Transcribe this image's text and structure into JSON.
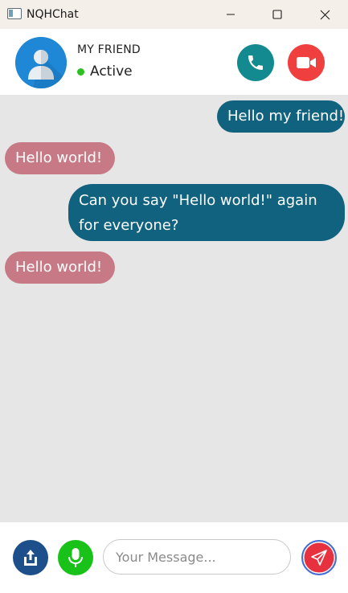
{
  "window": {
    "title": "NQHChat",
    "icons": [
      "app-window-icon",
      "minimize-icon",
      "maximize-icon",
      "close-icon"
    ]
  },
  "header": {
    "friend_name": "MY FRIEND",
    "status": "Active",
    "status_color": "#2cc020",
    "avatar_icon": "user-avatar-icon",
    "call_icon": "phone-icon",
    "video_icon": "video-camera-icon",
    "call_color": "#138a8f",
    "video_color": "#ef3f3f"
  },
  "messages": [
    {
      "direction": "outgoing",
      "text": "Hello my friend!"
    },
    {
      "direction": "incoming",
      "text": "Hello world!"
    },
    {
      "direction": "outgoing",
      "text": "Can you say \"Hello world!\" again for everyone?"
    },
    {
      "direction": "incoming",
      "text": "Hello world!"
    }
  ],
  "colors": {
    "outgoing_bubble": "#10627f",
    "incoming_bubble": "#c77a86",
    "chat_background": "#e6e6e6"
  },
  "composer": {
    "placeholder": "Your Message...",
    "value": "",
    "share_icon": "share-upload-icon",
    "mic_icon": "microphone-icon",
    "send_icon": "send-paper-plane-icon",
    "share_color": "#1d4f8a",
    "mic_color": "#19c219",
    "send_color": "#e8313e"
  }
}
